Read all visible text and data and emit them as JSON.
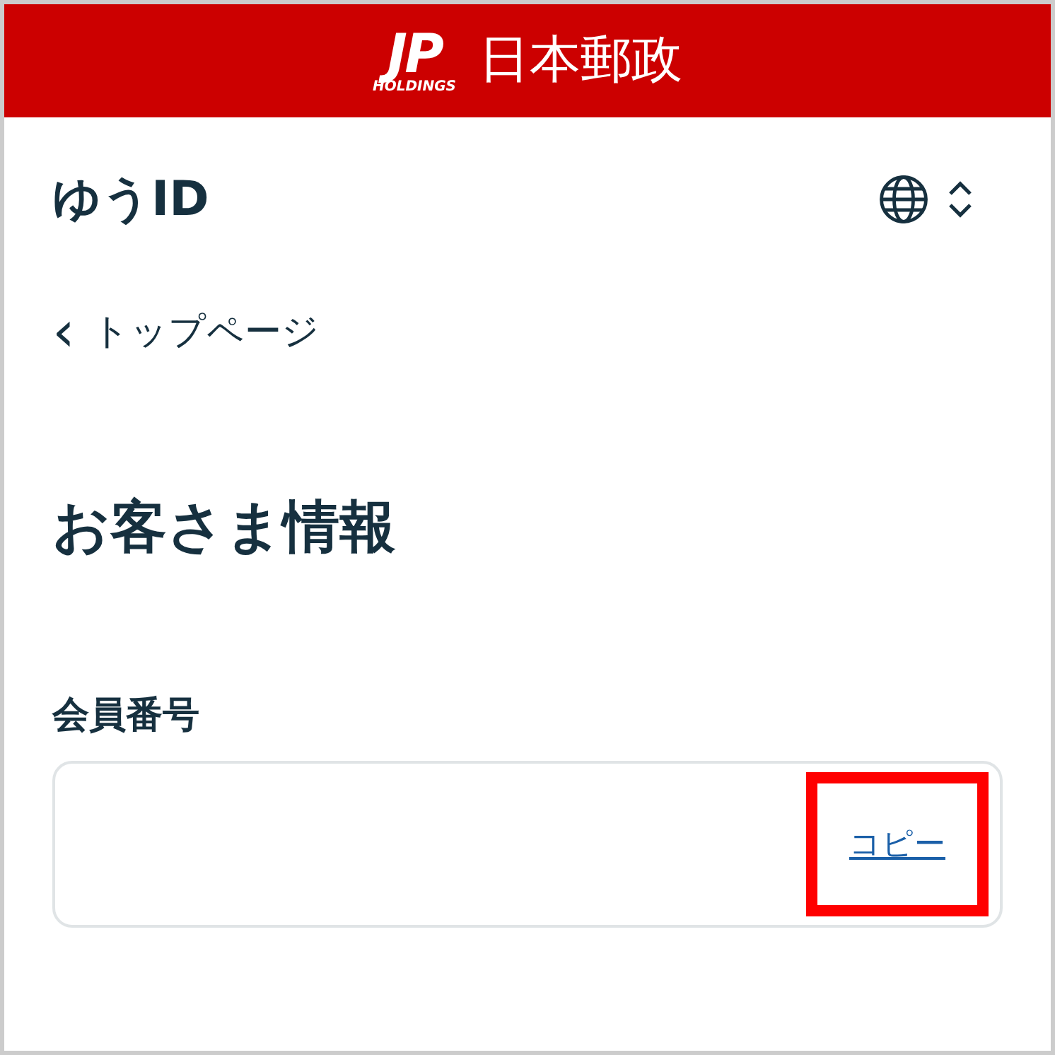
{
  "header": {
    "logo_mark": "JP",
    "logo_sub": "HOLDINGS",
    "title": "日本郵政"
  },
  "app_title": "ゆうID",
  "back_link": {
    "icon": "‹",
    "label": "トップページ"
  },
  "page_title": "お客さま情報",
  "member_number": {
    "label": "会員番号",
    "copy_link": {
      "label": "コピー",
      "highlighted": true
    }
  }
}
